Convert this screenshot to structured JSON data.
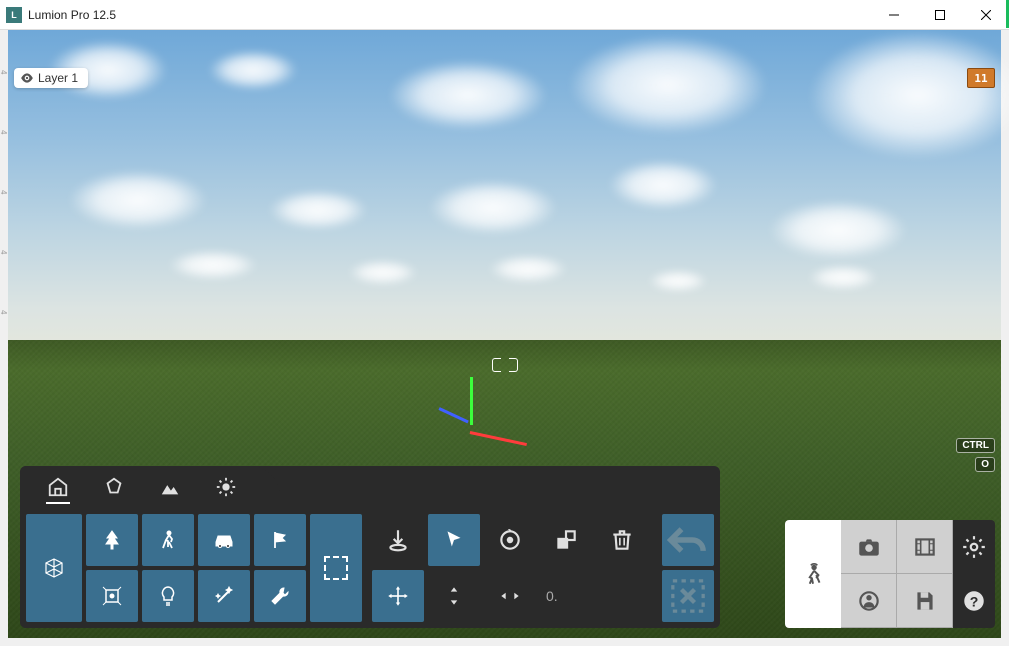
{
  "app": {
    "title": "Lumion Pro 12.5"
  },
  "layer": {
    "label": "Layer 1"
  },
  "fps": {
    "value": "11"
  },
  "keys": {
    "ctrl": "CTRL",
    "o": "O"
  },
  "tabs": {
    "active": "objects"
  },
  "object_types": {
    "main": "import-model",
    "row1": [
      "nature",
      "people",
      "transport",
      "outdoor"
    ],
    "row2": [
      "effects",
      "lights",
      "tools",
      "utilities"
    ]
  },
  "tools_top": [
    "place",
    "select",
    "rotate",
    "scale",
    "delete"
  ],
  "tools_bottom": {
    "move": "move",
    "height": "height",
    "spacing": "spacing",
    "value": "0."
  },
  "undo": {
    "undo": "undo",
    "cancel": "cancel-selection"
  },
  "output": {
    "main": "build-mode",
    "grid": [
      "photo",
      "movie",
      "panorama",
      "save"
    ],
    "side": [
      "settings",
      "help"
    ]
  }
}
